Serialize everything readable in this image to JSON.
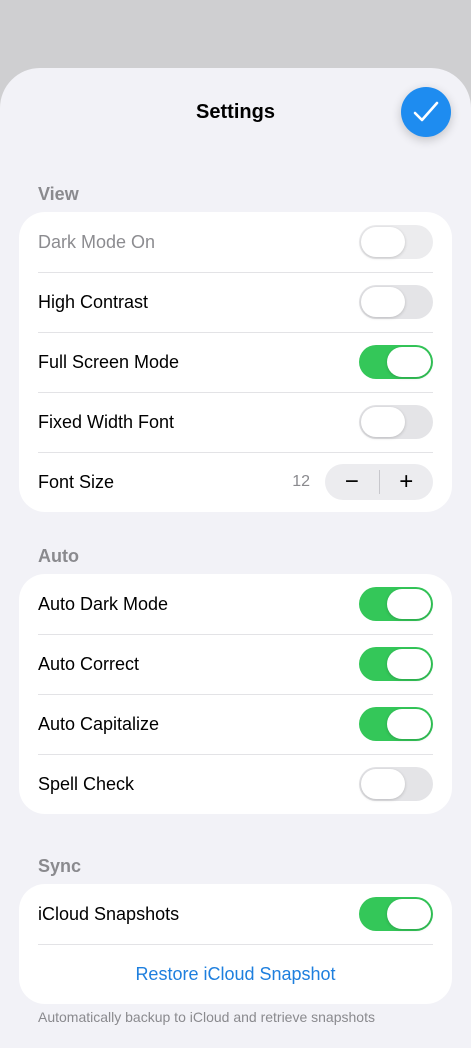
{
  "header": {
    "title": "Settings",
    "done_icon": "checkmark-icon"
  },
  "sections": {
    "view": {
      "title": "View",
      "dark_mode": {
        "label": "Dark Mode On",
        "on": false,
        "disabled": true
      },
      "high_contrast": {
        "label": "High Contrast",
        "on": false
      },
      "full_screen": {
        "label": "Full Screen Mode",
        "on": true
      },
      "fixed_width": {
        "label": "Fixed Width Font",
        "on": false
      },
      "font_size": {
        "label": "Font Size",
        "value": "12",
        "minus": "−",
        "plus": "+"
      }
    },
    "auto": {
      "title": "Auto",
      "auto_dark": {
        "label": "Auto Dark Mode",
        "on": true
      },
      "auto_correct": {
        "label": "Auto Correct",
        "on": true
      },
      "auto_capitalize": {
        "label": "Auto Capitalize",
        "on": true
      },
      "spell_check": {
        "label": "Spell Check",
        "on": false
      }
    },
    "sync": {
      "title": "Sync",
      "icloud_snapshots": {
        "label": "iCloud Snapshots",
        "on": true
      },
      "restore": {
        "label": "Restore iCloud Snapshot"
      },
      "footer": "Automatically backup to iCloud and retrieve snapshots"
    }
  },
  "colors": {
    "accent": "#1e8cf0",
    "toggle_on": "#34c759",
    "link": "#1e7fde"
  }
}
